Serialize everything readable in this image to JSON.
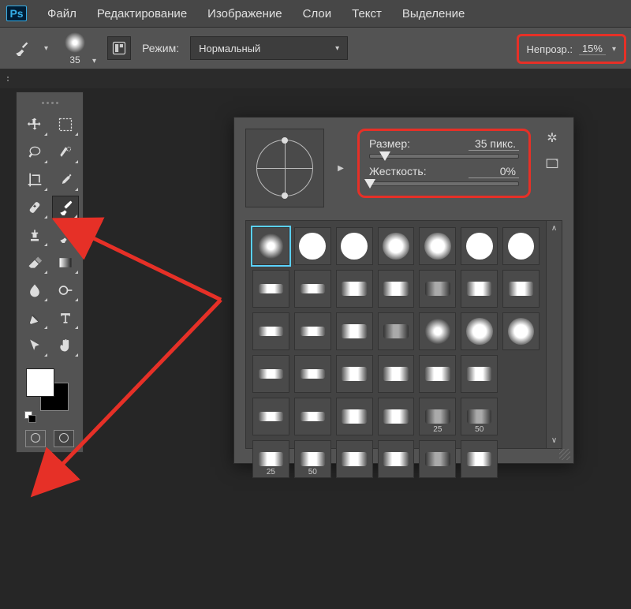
{
  "menu": {
    "items": [
      "Файл",
      "Редактирование",
      "Изображение",
      "Слои",
      "Текст",
      "Выделение"
    ]
  },
  "options": {
    "brush_size": "35",
    "mode_label": "Режим:",
    "mode_value": "Нормальный",
    "opacity_label": "Непрозр.:",
    "opacity_value": "15%"
  },
  "brush_panel": {
    "size_label": "Размер:",
    "size_value": "35 пикс.",
    "hardness_label": "Жесткость:",
    "hardness_value": "0%",
    "size_pos_pct": 10,
    "hardness_pos_pct": 0
  },
  "tool_names": {
    "move": "move-tool",
    "marquee": "rect-marquee-tool",
    "lasso": "lasso-tool",
    "quick_select": "quick-select-tool",
    "crop": "crop-tool",
    "eyedropper": "eyedropper-tool",
    "heal": "healing-brush-tool",
    "brush": "brush-tool",
    "stamp": "clone-stamp-tool",
    "history": "history-brush-tool",
    "eraser": "eraser-tool",
    "gradient": "gradient-tool",
    "blur": "blur-tool",
    "dodge": "dodge-tool",
    "pen": "pen-tool",
    "type": "type-tool",
    "path": "path-select-tool",
    "hand": "hand-tool"
  },
  "presets": {
    "row5_nums": [
      "25",
      "50"
    ],
    "row6_nums": [
      "25",
      "50"
    ]
  },
  "highlight_color": "#e63027"
}
